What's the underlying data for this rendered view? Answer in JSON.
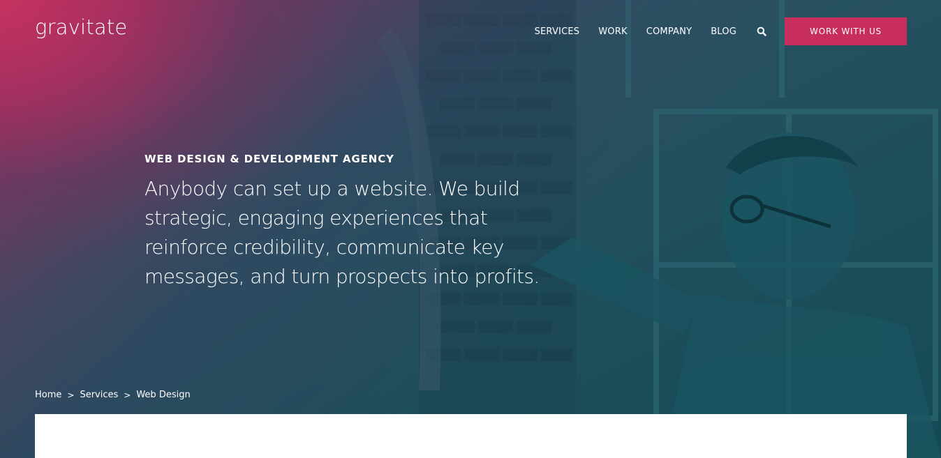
{
  "header": {
    "logo": "gravitate",
    "nav": [
      "SERVICES",
      "WORK",
      "COMPANY",
      "BLOG"
    ],
    "search_icon": "search-icon",
    "cta_label": "WORK WITH US"
  },
  "hero": {
    "eyebrow": "WEB DESIGN & DEVELOPMENT AGENCY",
    "headline": "Anybody can set up a website. We build strategic, engaging experiences that reinforce credibility, communicate key messages, and turn prospects into profits."
  },
  "breadcrumb": {
    "items": [
      "Home",
      "Services",
      "Web Design"
    ],
    "separator": ">"
  },
  "colors": {
    "accent": "#c72e5c",
    "overlay_teal": "#1d4d5a",
    "overlay_magenta": "#c8325f"
  }
}
